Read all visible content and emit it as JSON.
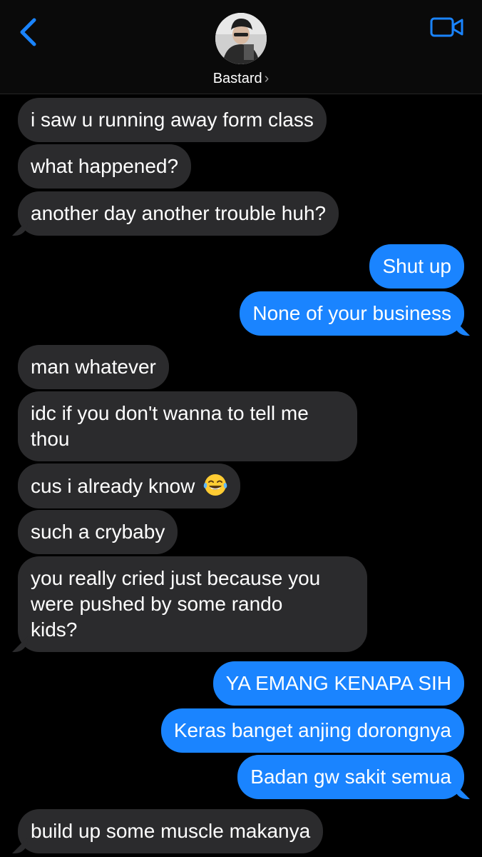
{
  "header": {
    "contact_name": "Bastard",
    "chevron": "›",
    "back_icon": "chevron-left-icon",
    "video_icon": "video-camera-icon",
    "accent_color": "#1a84ff"
  },
  "messages": [
    {
      "from": "them",
      "text": "i saw u running away form class"
    },
    {
      "from": "them",
      "text": "what happened?"
    },
    {
      "from": "them",
      "text": "another day another trouble huh?"
    },
    {
      "from": "me",
      "text": "Shut up"
    },
    {
      "from": "me",
      "text": "None of your business"
    },
    {
      "from": "them",
      "text": "man whatever"
    },
    {
      "from": "them",
      "text": "idc if you don't wanna to tell me thou"
    },
    {
      "from": "them",
      "text": "cus i already know",
      "emoji": "face-with-tears-of-joy"
    },
    {
      "from": "them",
      "text": "such a crybaby"
    },
    {
      "from": "them",
      "text": "you really cried just because you were pushed by some rando kids?"
    },
    {
      "from": "me",
      "text": "YA EMANG KENAPA SIH"
    },
    {
      "from": "me",
      "text": "Keras banget anjing dorongnya"
    },
    {
      "from": "me",
      "text": "Badan gw sakit semua"
    },
    {
      "from": "them",
      "text": "build up some muscle makanya"
    }
  ],
  "lines": {
    "m6": [
      "idc if you don't wanna to tell me",
      "thou"
    ],
    "m9": [
      "you really cried just because you",
      "were pushed by some rando",
      "kids?"
    ]
  }
}
